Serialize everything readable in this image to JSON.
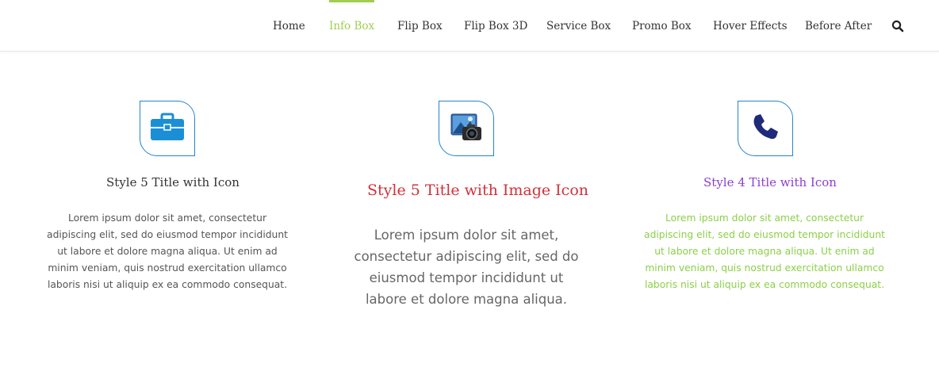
{
  "nav": {
    "items": [
      {
        "label": "Home",
        "active": false
      },
      {
        "label": "Info Box",
        "active": true
      },
      {
        "label": "Flip Box",
        "active": false
      },
      {
        "label": "Flip Box 3D",
        "active": false
      },
      {
        "label": "Service Box",
        "active": false
      },
      {
        "label": "Promo Box",
        "active": false
      },
      {
        "label": "Hover Effects",
        "active": false
      },
      {
        "label": "Before After",
        "active": false
      }
    ],
    "search_icon": "search-icon",
    "active_color": "#a0ce4e"
  },
  "boxes": [
    {
      "icon": "briefcase-icon",
      "icon_color": "#1a8fd6",
      "title": "Style 5 Title with Icon",
      "title_color": "#333333",
      "text": "Lorem ipsum dolor sit amet, consectetur adipiscing elit, sed do eiusmod tempor incididunt ut labore et dolore magna aliqua. Ut enim ad minim veniam, quis nostrud exercitation ullamco laboris nisi ut aliquip ex ea commodo consequat.",
      "text_color": "#555555"
    },
    {
      "icon": "camera-photo-icon",
      "title": "Style 5 Title with Image Icon",
      "title_color": "#d0323a",
      "text": "Lorem ipsum dolor sit amet, consectetur adipiscing elit, sed do eiusmod tempor incididunt ut labore et dolore magna aliqua.",
      "text_color": "#666666"
    },
    {
      "icon": "phone-icon",
      "icon_color": "#1f2a7a",
      "title": "Style 4 Title with Icon",
      "title_color": "#8a3fd0",
      "text": "Lorem ipsum dolor sit amet, consectetur adipiscing elit, sed do eiusmod tempor incididunt ut labore et dolore magna aliqua. Ut enim ad minim veniam, quis nostrud exercitation ullamco laboris nisi ut aliquip ex ea commodo consequat.",
      "text_color": "#8ccf48"
    }
  ],
  "border_color": "#2585c8"
}
